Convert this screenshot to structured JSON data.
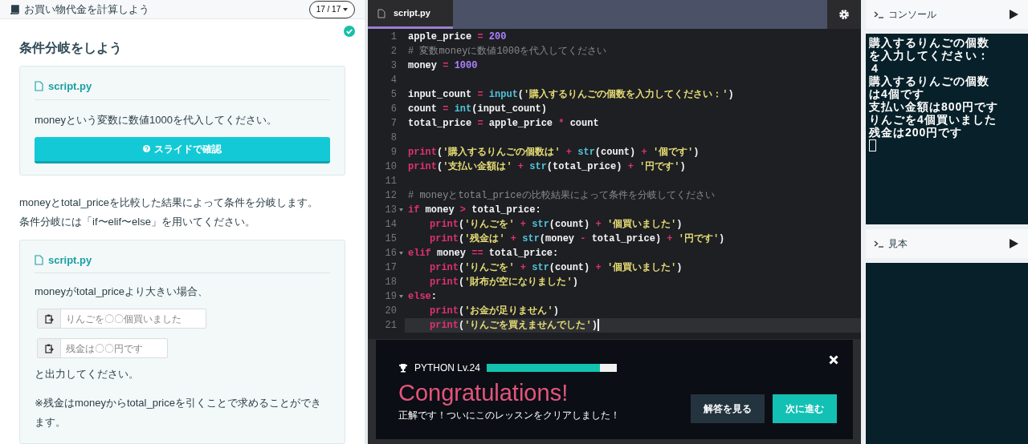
{
  "lesson": {
    "title": "お買い物代金を計算しよう",
    "progress": "17 / 17",
    "completed": true,
    "heading": "条件分岐をしよう",
    "task1": {
      "file": "script.py",
      "text": "moneyという変数に数値1000を代入してください。",
      "button": "スライドで確認"
    },
    "paragraphs": [
      "moneyとtotal_priceを比較した結果によって条件を分岐します。",
      "条件分岐には「if〜elif〜else」を用いてください。"
    ],
    "task2": {
      "file": "script.py",
      "text": "moneyがtotal_priceより大きい場合、",
      "snippets": [
        "りんごを〇〇個買いました",
        "残金は〇〇円です"
      ],
      "after": "と出力してください。",
      "note": "※残金はmoneyからtotal_priceを引くことで求めることができます。"
    }
  },
  "editor": {
    "tab": "script.py",
    "lines": [
      {
        "n": "1",
        "fold": false,
        "indent": false,
        "active": false,
        "tokens": [
          {
            "kind": "name",
            "t": "apple_price"
          },
          {
            "kind": "operator",
            "t": " = "
          },
          {
            "kind": "number",
            "t": "200"
          }
        ]
      },
      {
        "n": "2",
        "fold": false,
        "indent": false,
        "active": false,
        "tokens": [
          {
            "kind": "comment",
            "t": "# 変数moneyに数値1000を代入してください"
          }
        ]
      },
      {
        "n": "3",
        "fold": false,
        "indent": false,
        "active": false,
        "tokens": [
          {
            "kind": "name",
            "t": "money"
          },
          {
            "kind": "operator",
            "t": " = "
          },
          {
            "kind": "number",
            "t": "1000"
          }
        ]
      },
      {
        "n": "4",
        "fold": false,
        "active": false
      },
      {
        "n": "5",
        "fold": false,
        "indent": false,
        "active": false,
        "tokens": [
          {
            "kind": "name",
            "t": "input_count"
          },
          {
            "kind": "operator",
            "t": " = "
          },
          {
            "kind": "builtin",
            "t": "input"
          },
          {
            "kind": "name",
            "t": "("
          },
          {
            "kind": "string",
            "t": "'購入するりんごの個数を入力してください：'"
          },
          {
            "kind": "name",
            "t": ")"
          }
        ]
      },
      {
        "n": "6",
        "fold": false,
        "indent": false,
        "active": false,
        "tokens": [
          {
            "kind": "name",
            "t": "count"
          },
          {
            "kind": "operator",
            "t": " = "
          },
          {
            "kind": "builtin",
            "t": "int"
          },
          {
            "kind": "name",
            "t": "(input_count)"
          }
        ]
      },
      {
        "n": "7",
        "fold": false,
        "indent": false,
        "active": false,
        "tokens": [
          {
            "kind": "name",
            "t": "total_price"
          },
          {
            "kind": "operator",
            "t": " = "
          },
          {
            "kind": "name",
            "t": "apple_price"
          },
          {
            "kind": "operator",
            "t": " * "
          },
          {
            "kind": "name",
            "t": "count"
          }
        ]
      },
      {
        "n": "8",
        "fold": false,
        "active": false
      },
      {
        "n": "9",
        "fold": false,
        "indent": false,
        "active": false,
        "tokens": [
          {
            "kind": "keyword",
            "t": "print"
          },
          {
            "kind": "name",
            "t": "("
          },
          {
            "kind": "string",
            "t": "'購入するりんごの個数は'"
          },
          {
            "kind": "operator",
            "t": " + "
          },
          {
            "kind": "builtin",
            "t": "str"
          },
          {
            "kind": "name",
            "t": "(count)"
          },
          {
            "kind": "operator",
            "t": " + "
          },
          {
            "kind": "string",
            "t": "'個です'"
          },
          {
            "kind": "name",
            "t": ")"
          }
        ]
      },
      {
        "n": "10",
        "fold": false,
        "indent": false,
        "active": false,
        "tokens": [
          {
            "kind": "keyword",
            "t": "print"
          },
          {
            "kind": "name",
            "t": "("
          },
          {
            "kind": "string",
            "t": "'支払い金額は'"
          },
          {
            "kind": "operator",
            "t": " + "
          },
          {
            "kind": "builtin",
            "t": "str"
          },
          {
            "kind": "name",
            "t": "(total_price)"
          },
          {
            "kind": "operator",
            "t": " + "
          },
          {
            "kind": "string",
            "t": "'円です'"
          },
          {
            "kind": "name",
            "t": ")"
          }
        ]
      },
      {
        "n": "11",
        "fold": false,
        "active": false
      },
      {
        "n": "12",
        "fold": false,
        "indent": false,
        "active": false,
        "tokens": [
          {
            "kind": "comment",
            "t": "# moneyとtotal_priceの比較結果によって条件を分岐してください"
          }
        ]
      },
      {
        "n": "13",
        "fold": true,
        "indent": false,
        "active": false,
        "tokens": [
          {
            "kind": "keyword",
            "t": "if"
          },
          {
            "kind": "name",
            "t": " money"
          },
          {
            "kind": "operator",
            "t": " > "
          },
          {
            "kind": "name",
            "t": "total_price:"
          }
        ]
      },
      {
        "n": "14",
        "fold": false,
        "indent": true,
        "active": false,
        "tokens": [
          {
            "kind": "keyword",
            "t": "print"
          },
          {
            "kind": "name",
            "t": "("
          },
          {
            "kind": "string",
            "t": "'りんごを'"
          },
          {
            "kind": "operator",
            "t": " + "
          },
          {
            "kind": "builtin",
            "t": "str"
          },
          {
            "kind": "name",
            "t": "(count)"
          },
          {
            "kind": "operator",
            "t": " + "
          },
          {
            "kind": "string",
            "t": "'個買いました'"
          },
          {
            "kind": "name",
            "t": ")"
          }
        ]
      },
      {
        "n": "15",
        "fold": false,
        "indent": true,
        "active": false,
        "tokens": [
          {
            "kind": "keyword",
            "t": "print"
          },
          {
            "kind": "name",
            "t": "("
          },
          {
            "kind": "string",
            "t": "'残金は'"
          },
          {
            "kind": "operator",
            "t": " + "
          },
          {
            "kind": "builtin",
            "t": "str"
          },
          {
            "kind": "name",
            "t": "(money"
          },
          {
            "kind": "operator",
            "t": " - "
          },
          {
            "kind": "name",
            "t": "total_price)"
          },
          {
            "kind": "operator",
            "t": " + "
          },
          {
            "kind": "string",
            "t": "'円です'"
          },
          {
            "kind": "name",
            "t": ")"
          }
        ]
      },
      {
        "n": "16",
        "fold": true,
        "indent": false,
        "active": false,
        "tokens": [
          {
            "kind": "keyword",
            "t": "elif"
          },
          {
            "kind": "name",
            "t": " money"
          },
          {
            "kind": "operator",
            "t": " == "
          },
          {
            "kind": "name",
            "t": "total_price:"
          }
        ]
      },
      {
        "n": "17",
        "fold": false,
        "indent": true,
        "active": false,
        "tokens": [
          {
            "kind": "keyword",
            "t": "print"
          },
          {
            "kind": "name",
            "t": "("
          },
          {
            "kind": "string",
            "t": "'りんごを'"
          },
          {
            "kind": "operator",
            "t": " + "
          },
          {
            "kind": "builtin",
            "t": "str"
          },
          {
            "kind": "name",
            "t": "(count)"
          },
          {
            "kind": "operator",
            "t": " + "
          },
          {
            "kind": "string",
            "t": "'個買いました'"
          },
          {
            "kind": "name",
            "t": ")"
          }
        ]
      },
      {
        "n": "18",
        "fold": false,
        "indent": true,
        "active": false,
        "tokens": [
          {
            "kind": "keyword",
            "t": "print"
          },
          {
            "kind": "name",
            "t": "("
          },
          {
            "kind": "string",
            "t": "'財布が空になりました'"
          },
          {
            "kind": "name",
            "t": ")"
          }
        ]
      },
      {
        "n": "19",
        "fold": true,
        "indent": false,
        "active": false,
        "tokens": [
          {
            "kind": "keyword",
            "t": "else"
          },
          {
            "kind": "name",
            "t": ":"
          }
        ]
      },
      {
        "n": "20",
        "fold": false,
        "indent": true,
        "active": false,
        "tokens": [
          {
            "kind": "keyword",
            "t": "print"
          },
          {
            "kind": "name",
            "t": "("
          },
          {
            "kind": "string",
            "t": "'お金が足りません'"
          },
          {
            "kind": "name",
            "t": ")"
          }
        ]
      },
      {
        "n": "21",
        "fold": false,
        "indent": true,
        "active": true,
        "tokens": [
          {
            "kind": "keyword",
            "t": "print"
          },
          {
            "kind": "name",
            "t": "("
          },
          {
            "kind": "string",
            "t": "'りんごを買えませんでした'"
          },
          {
            "kind": "name",
            "t": ")"
          }
        ]
      }
    ]
  },
  "result": {
    "course": "PYTHON Lv.24",
    "level": 0.87,
    "headline": "Congratulations!",
    "message": "正解です！ついにこのレッスンをクリアしました！",
    "buttons": [
      {
        "label": "解答を見る",
        "kind": "secondary"
      },
      {
        "label": "次に進む",
        "kind": "primary"
      }
    ]
  },
  "console": {
    "title": "コンソール",
    "lines": [
      "購入するりんごの個数",
      "を入力してください：",
      "４",
      "購入するりんごの個数",
      "は4個です",
      "支払い金額は800円です",
      "りんごを4個買いました",
      "残金は200円です"
    ]
  },
  "sample": {
    "title": "見本"
  }
}
